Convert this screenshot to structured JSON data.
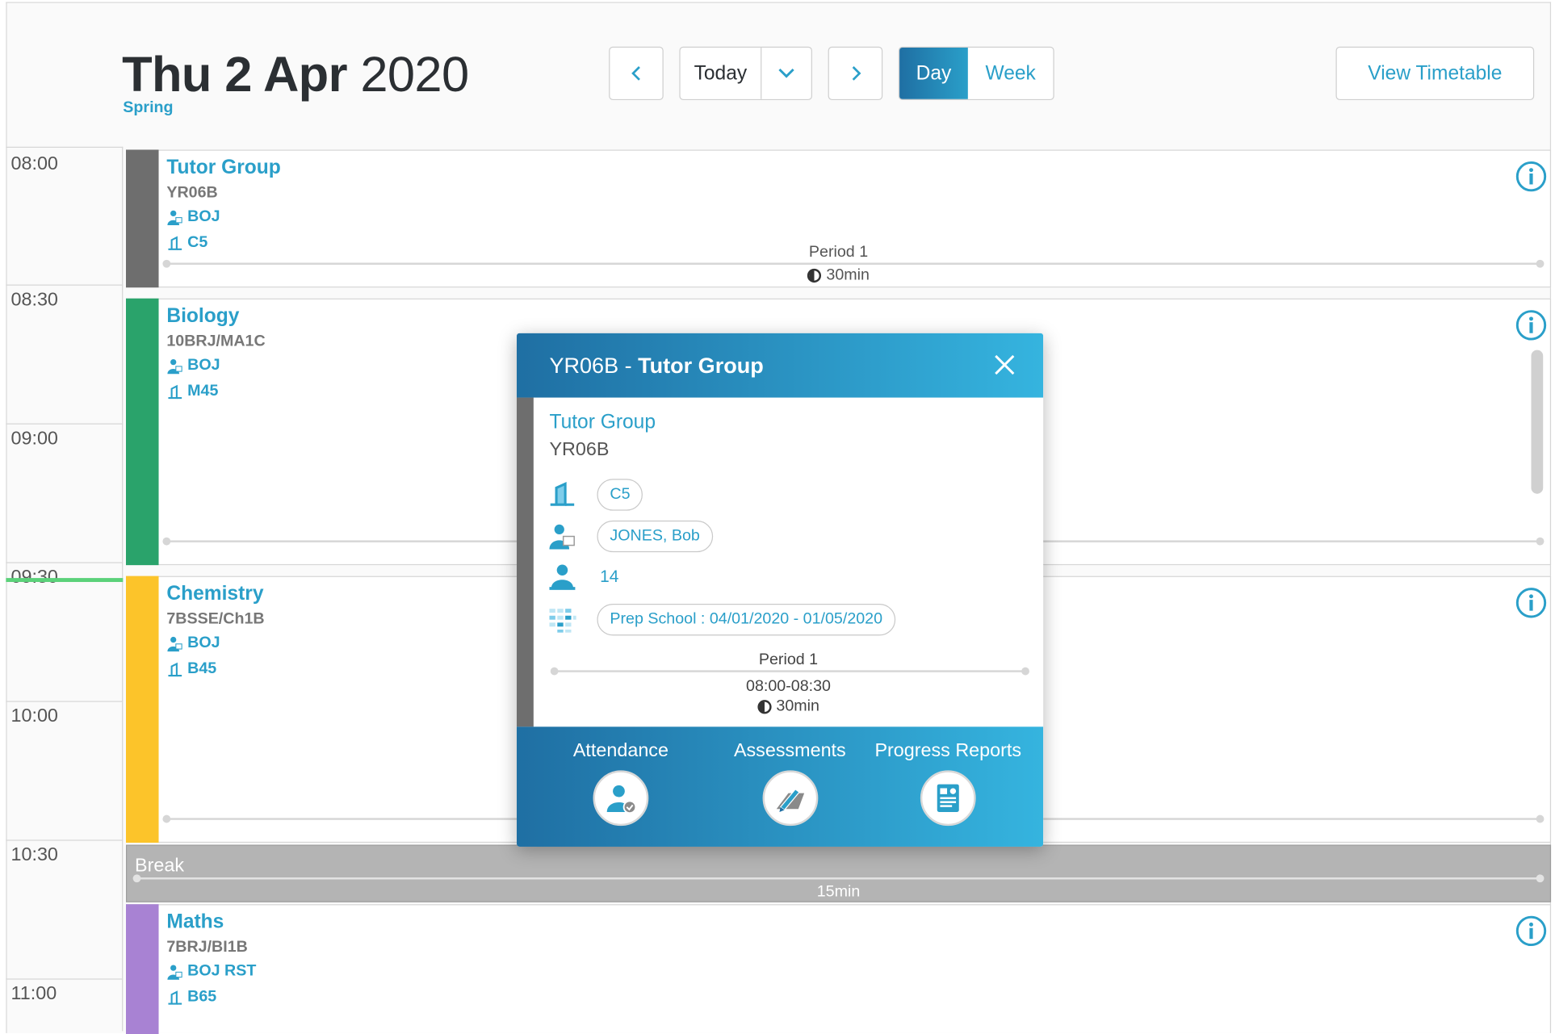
{
  "header": {
    "date_bold": "Thu 2 Apr",
    "year": "2020",
    "season": "Spring",
    "today_label": "Today",
    "view_day": "Day",
    "view_week": "Week",
    "view_timetable": "View Timetable",
    "prev_icon": "chevron-left-icon",
    "next_icon": "chevron-right-icon",
    "dropdown_icon": "chevron-down-icon"
  },
  "times": [
    "08:00",
    "08:30",
    "09:00",
    "09:30",
    "10:00",
    "10:30",
    "11:00"
  ],
  "lessons": [
    {
      "title": "Tutor Group",
      "code": "YR06B",
      "teacher": "BOJ",
      "room": "C5",
      "period": "Period 1",
      "duration": "30min",
      "color": "#6e6e6e"
    },
    {
      "title": "Biology",
      "code": "10BRJ/MA1C",
      "teacher": "BOJ",
      "room": "M45",
      "color": "#2aa36b"
    },
    {
      "title": "Chemistry",
      "code": "7BSSE/Ch1B",
      "teacher": "BOJ",
      "room": "B45",
      "color": "#fcc42a"
    },
    {
      "title": "Maths",
      "code": "7BRJ/BI1B",
      "teacher": "BOJ RST",
      "room": "B65",
      "color": "#a882d3"
    }
  ],
  "break": {
    "label": "Break",
    "duration": "15min"
  },
  "popup": {
    "title_code": "YR06B",
    "title_sep": " - ",
    "title_name": "Tutor Group",
    "subject": "Tutor Group",
    "group": "YR06B",
    "room": "C5",
    "teacher": "JONES, Bob",
    "students": "14",
    "term": "Prep School : 04/01/2020 - 01/05/2020",
    "period": "Period 1",
    "time_range": "08:00-08:30",
    "duration": "30min",
    "actions": [
      "Attendance",
      "Assessments",
      "Progress Reports"
    ]
  },
  "colors": {
    "accent": "#2a9fc9",
    "header_gradient_start": "#1f6fa3",
    "header_gradient_end": "#35b4df",
    "now_line": "#5bd17a"
  }
}
